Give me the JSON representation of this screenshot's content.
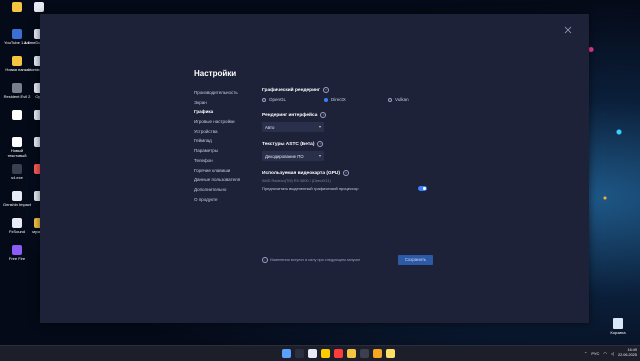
{
  "desktop": {
    "icons": [
      {
        "label": "",
        "color": "#f5c542"
      },
      {
        "label": "",
        "color": "#e8ebf5"
      },
      {
        "label": "YouTube 1.1.1",
        "color": "#3b6fd6"
      },
      {
        "label": "AnimeDownloade",
        "color": "#e8ebf5"
      },
      {
        "label": "Новая папка",
        "color": "#f5c542"
      },
      {
        "label": "Atomic Heart",
        "color": "#e8ebf5"
      },
      {
        "label": "Resident Evil 2",
        "color": "#7a7f8f"
      },
      {
        "label": "Ops",
        "color": "#e8ebf5"
      },
      {
        "label": "",
        "color": "#ffffff"
      },
      {
        "label": "",
        "color": "#e8ebf5"
      },
      {
        "label": "Новый текстовый",
        "color": "#ffffff"
      },
      {
        "label": "",
        "color": "#e8ebf5"
      },
      {
        "label": "s4.exe",
        "color": "#3b3f4f"
      },
      {
        "label": "",
        "color": "#ff5a5a"
      },
      {
        "label": "Genshin Impact",
        "color": "#e8ebf5"
      },
      {
        "label": "",
        "color": "#e8ebf5"
      },
      {
        "label": "FxSound",
        "color": "#e8ebf5"
      },
      {
        "label": "музыка",
        "color": "#f5c542"
      },
      {
        "label": "Free Fire",
        "color": "#8b5cf6"
      }
    ],
    "recycle_bin_label": "Корзина"
  },
  "settings": {
    "title": "Настройки",
    "nav": [
      "Производительность",
      "Экран",
      "Графика",
      "Игровые настройки",
      "Устройства",
      "Геймпад",
      "Параметры",
      "Телефон",
      "Горячие клавиши",
      "Данные пользователя",
      "Дополнительно",
      "О продукте"
    ],
    "active_nav_index": 2,
    "renderer": {
      "title": "Графический рендеринг",
      "options": [
        "OpenGL",
        "DirectX",
        "Vulkan"
      ],
      "selected": "DirectX"
    },
    "interface_renderer": {
      "title": "Рендеринг интерфейса",
      "value": "Авто"
    },
    "astc": {
      "title": "Текстуры ASTC (Бета)",
      "value": "Декодирование ПО"
    },
    "gpu": {
      "title": "Используемая видеокарта (GPU)",
      "value": "AMD Radeon(TM) RX 6600 / (DirectX11)",
      "prefer_dedicated_label": "Предпочитать выделенный графический процессор",
      "prefer_dedicated_on": true
    },
    "note": "Изменения вступят в силу при следующем запуске",
    "save_label": "Сохранить"
  },
  "taskbar": {
    "lang": "РУС",
    "time": "16:49",
    "date": "22.06.2025",
    "app_colors": [
      "#5aa0ff",
      "#2b2f3f",
      "#e8ebf5",
      "#ffcc00",
      "#ff3b3b",
      "#f5c542",
      "#3b3f4f",
      "#f5a623",
      "#ffe066"
    ]
  },
  "colors": {
    "accent": "#3b82f6",
    "window_bg": "#1e2239"
  }
}
